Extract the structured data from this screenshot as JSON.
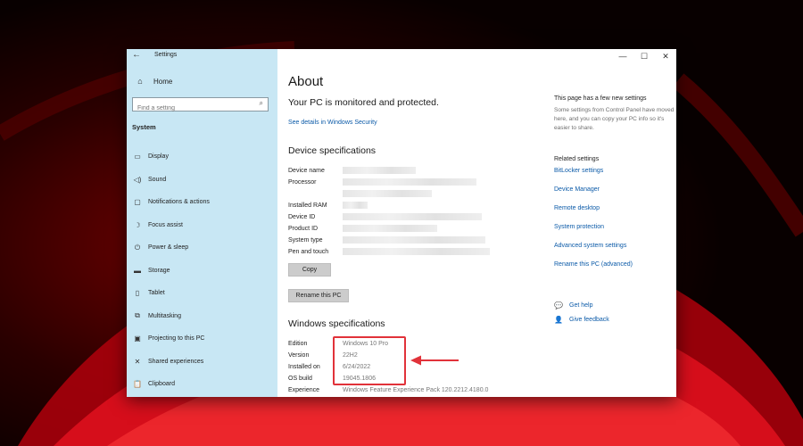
{
  "window": {
    "title": "Settings"
  },
  "window_controls": {
    "minimize": "—",
    "maximize": "☐",
    "close": "✕"
  },
  "sidebar": {
    "home_label": "Home",
    "search_placeholder": "Find a setting",
    "section_title": "System",
    "items": [
      {
        "label": "Display",
        "icon": "display-icon"
      },
      {
        "label": "Sound",
        "icon": "sound-icon"
      },
      {
        "label": "Notifications & actions",
        "icon": "notifications-icon"
      },
      {
        "label": "Focus assist",
        "icon": "moon-icon"
      },
      {
        "label": "Power & sleep",
        "icon": "power-icon"
      },
      {
        "label": "Storage",
        "icon": "storage-icon"
      },
      {
        "label": "Tablet",
        "icon": "tablet-icon"
      },
      {
        "label": "Multitasking",
        "icon": "multitasking-icon"
      },
      {
        "label": "Projecting to this PC",
        "icon": "projecting-icon"
      },
      {
        "label": "Shared experiences",
        "icon": "shared-experiences-icon"
      },
      {
        "label": "Clipboard",
        "icon": "clipboard-icon"
      }
    ]
  },
  "main": {
    "title": "About",
    "protected_text": "Your PC is monitored and protected.",
    "security_link": "See details in Windows Security",
    "device_specs": {
      "heading": "Device specifications",
      "rows": [
        {
          "label": "Device name"
        },
        {
          "label": "Processor"
        },
        {
          "label": "Installed RAM"
        },
        {
          "label": "Device ID"
        },
        {
          "label": "Product ID"
        },
        {
          "label": "System type"
        },
        {
          "label": "Pen and touch"
        }
      ],
      "copy_button": "Copy",
      "rename_button": "Rename this PC"
    },
    "windows_specs": {
      "heading": "Windows specifications",
      "rows": [
        {
          "label": "Edition",
          "value": "Windows 10 Pro"
        },
        {
          "label": "Version",
          "value": "22H2"
        },
        {
          "label": "Installed on",
          "value": "6/24/2022"
        },
        {
          "label": "OS build",
          "value": "19045.1806"
        },
        {
          "label": "Experience",
          "value": "Windows Feature Experience Pack 120.2212.4180.0"
        }
      ]
    }
  },
  "right_panel": {
    "new_settings_title": "This page has a few new settings",
    "new_settings_desc": "Some settings from Control Panel have moved here, and you can copy your PC info so it's easier to share.",
    "related_title": "Related settings",
    "links": [
      "BitLocker settings",
      "Device Manager",
      "Remote desktop",
      "System protection",
      "Advanced system settings",
      "Rename this PC (advanced)"
    ],
    "get_help": "Get help",
    "give_feedback": "Give feedback"
  },
  "colors": {
    "sidebar_bg": "#c8e7f4",
    "link": "#0b5aa8",
    "highlight": "#e1323a",
    "wallpaper": "#8a0000"
  }
}
